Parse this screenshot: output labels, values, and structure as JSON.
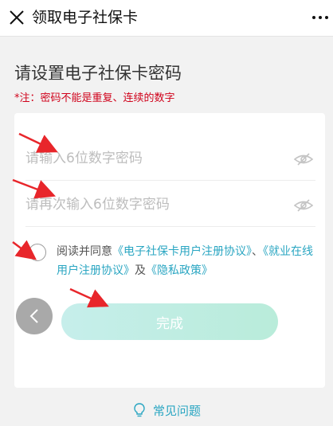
{
  "header": {
    "title": "领取电子社保卡",
    "close_icon": "close-icon",
    "more_icon": "more-icon"
  },
  "page": {
    "heading": "请设置电子社保卡密码",
    "note": "*注：密码不能是重复、连续的数字"
  },
  "form": {
    "password_placeholder": "请输入6位数字密码",
    "confirm_placeholder": "请再次输入6位数字密码",
    "eye_icon": "eye-hidden-icon"
  },
  "agreement": {
    "prefix": "阅读并同意",
    "link1": "《电子社保卡用户注册协议》",
    "sep": "、",
    "link2": "《就业在线用户注册协议》",
    "and": "及",
    "link3": "《隐私政策》"
  },
  "actions": {
    "submit_label": "完成",
    "back_icon": "chevron-left-icon"
  },
  "footer": {
    "faq_label": "常见问题",
    "faq_icon": "lightbulb-icon"
  },
  "colors": {
    "accent": "#2aa6c2",
    "note_red": "#d0021b",
    "annotation_arrow": "#e8262b"
  }
}
